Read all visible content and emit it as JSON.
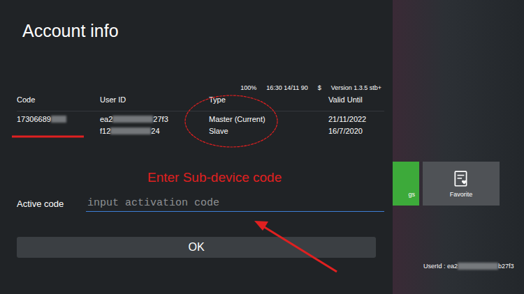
{
  "dialog": {
    "title": "Account info",
    "status_bar": {
      "battery": "100%",
      "datetime": "16:30 14/11 90",
      "currency": "$",
      "version": "Version 1.3.5 stb+"
    },
    "table": {
      "columns": [
        "Code",
        "User ID",
        "Type",
        "Valid Until"
      ],
      "account_code": "17306689",
      "rows": [
        {
          "user_id_start": "ea2",
          "user_id_end": "27f3",
          "type": "Master (Current)",
          "valid_until": "21/11/2022"
        },
        {
          "user_id_start": "f12",
          "user_id_end": "24",
          "type": "Slave",
          "valid_until": "16/7/2020"
        }
      ]
    },
    "active_code": {
      "label": "Active code",
      "placeholder": "input activation code"
    },
    "buttons": [
      "OK"
    ]
  },
  "annotation": {
    "text": "Enter Sub-device code"
  },
  "tiles": [
    {
      "label": "gs",
      "color": "#3daa3a"
    },
    {
      "label": "Favorite",
      "color": "#4f5256"
    }
  ],
  "user_id_footer": {
    "prefix": "UserId : ea2",
    "suffix": "b27f3"
  }
}
